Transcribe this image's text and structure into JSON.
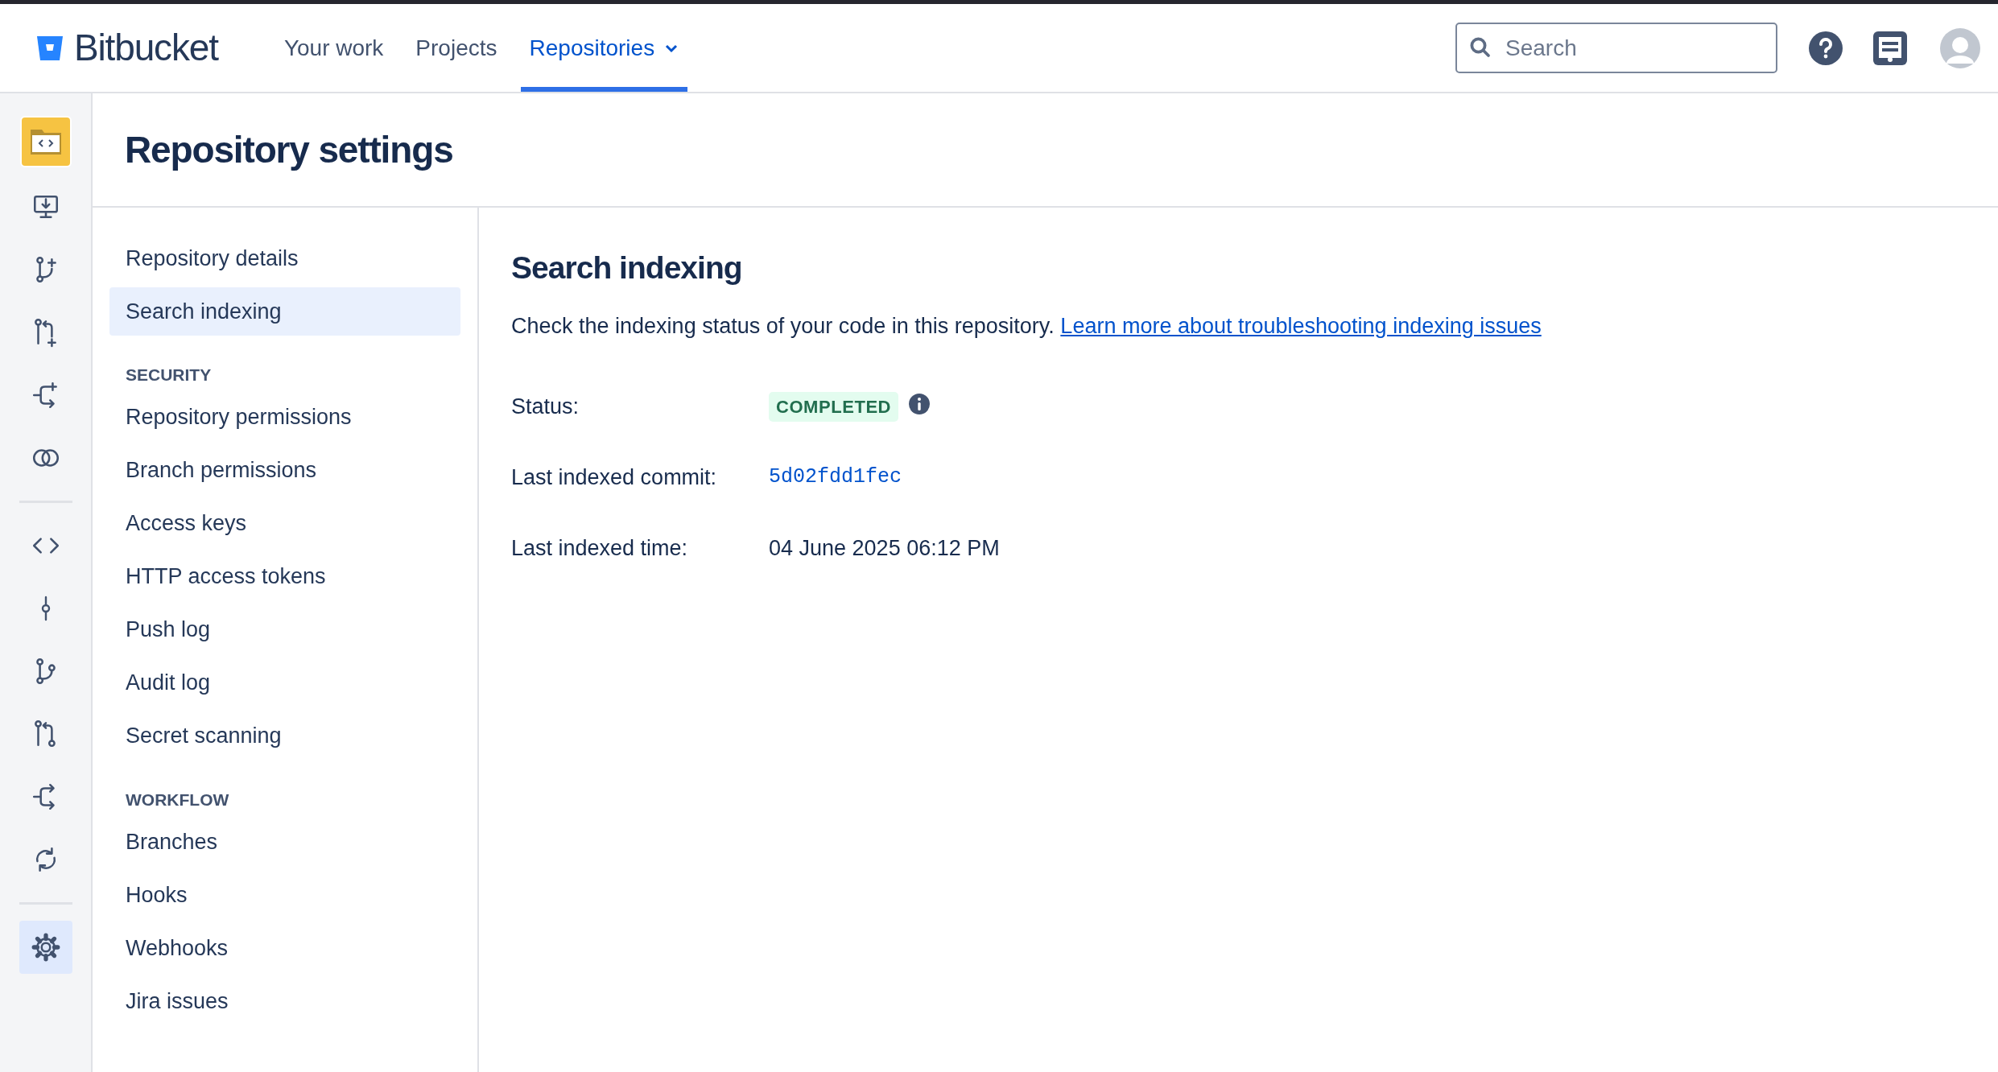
{
  "header": {
    "logo_text": "Bitbucket",
    "nav": [
      {
        "label": "Your work",
        "selected": false,
        "dropdown": false
      },
      {
        "label": "Projects",
        "selected": false,
        "dropdown": false
      },
      {
        "label": "Repositories",
        "selected": true,
        "dropdown": true
      }
    ],
    "search": {
      "placeholder": "Search"
    }
  },
  "sidebar": {
    "items": [
      {
        "selected": false
      },
      {
        "selected": false
      },
      {
        "selected": false
      },
      {
        "selected": false
      },
      {
        "selected": false
      },
      {
        "selected": false
      },
      {
        "selected": false
      },
      {
        "selected": false
      },
      {
        "selected": false
      },
      {
        "selected": false
      },
      {
        "selected": false
      },
      {
        "selected": true
      }
    ]
  },
  "page_title": "Repository settings",
  "settings_nav": [
    {
      "kind": "item",
      "label": "Repository details",
      "selected": false
    },
    {
      "kind": "item",
      "label": "Search indexing",
      "selected": true
    },
    {
      "kind": "section",
      "label": "SECURITY"
    },
    {
      "kind": "item",
      "label": "Repository permissions",
      "selected": false
    },
    {
      "kind": "item",
      "label": "Branch permissions",
      "selected": false
    },
    {
      "kind": "item",
      "label": "Access keys",
      "selected": false
    },
    {
      "kind": "item",
      "label": "HTTP access tokens",
      "selected": false
    },
    {
      "kind": "item",
      "label": "Push log",
      "selected": false
    },
    {
      "kind": "item",
      "label": "Audit log",
      "selected": false
    },
    {
      "kind": "item",
      "label": "Secret scanning",
      "selected": false
    },
    {
      "kind": "section",
      "label": "WORKFLOW"
    },
    {
      "kind": "item",
      "label": "Branches",
      "selected": false
    },
    {
      "kind": "item",
      "label": "Hooks",
      "selected": false
    },
    {
      "kind": "item",
      "label": "Webhooks",
      "selected": false
    },
    {
      "kind": "item",
      "label": "Jira issues",
      "selected": false
    }
  ],
  "content": {
    "heading": "Search indexing",
    "description": "Check the indexing status of your code in this repository.",
    "link": "Learn more about troubleshooting indexing issues",
    "fields": [
      {
        "kind": "badge",
        "label": "Status:",
        "value": "COMPLETED"
      },
      {
        "kind": "commit",
        "label": "Last indexed commit:",
        "value": "5d02fdd1fec"
      },
      {
        "kind": "text",
        "label": "Last indexed time:",
        "value": "04 June 2025 06:12 PM"
      }
    ]
  }
}
